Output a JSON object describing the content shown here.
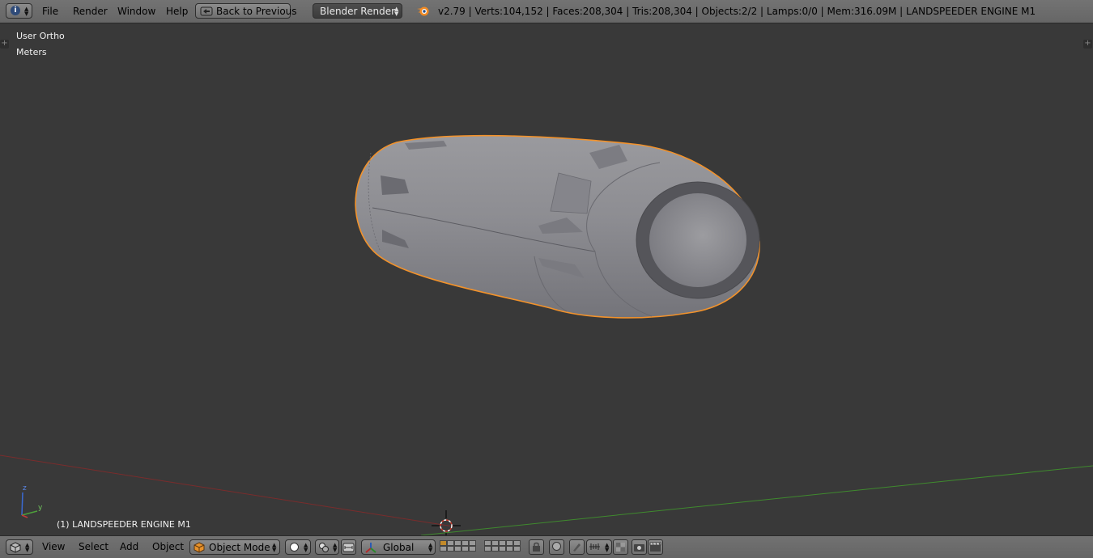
{
  "topbar": {
    "menus": [
      "File",
      "Render",
      "Window",
      "Help"
    ],
    "back_button": "Back to Previous",
    "render_engine": "Blender Render",
    "stats": "v2.79 | Verts:104,152 | Faces:208,304 | Tris:208,304 | Objects:2/2 | Lamps:0/0 | Mem:316.09M | LANDSPEEDER ENGINE M1"
  },
  "viewport": {
    "view_name": "User Ortho",
    "units": "Meters",
    "object_label": "(1) LANDSPEEDER ENGINE M1",
    "axis_z": "z",
    "axis_y": "y"
  },
  "bottombar": {
    "menus": [
      "View",
      "Select",
      "Add",
      "Object"
    ],
    "mode": "Object Mode",
    "orientation": "Global"
  },
  "colors": {
    "background": "#393939",
    "selection_outline": "#f2922b",
    "x_axis": "#8a2a2a",
    "y_axis": "#3b8a2a",
    "mesh": "#8e8e92"
  }
}
